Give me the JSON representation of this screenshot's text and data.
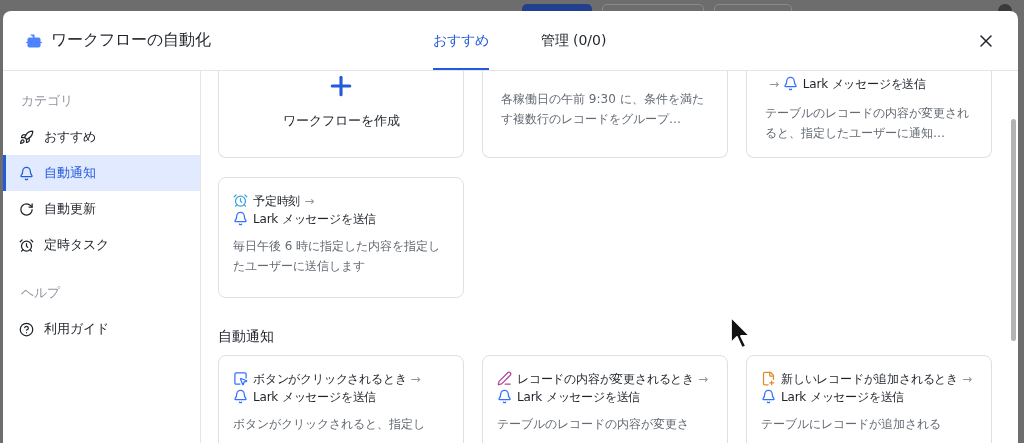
{
  "dialog": {
    "title": "ワークフローの自動化",
    "tabs": [
      {
        "label": "おすすめ",
        "selected": true
      },
      {
        "label": "管理 (0/0)",
        "selected": false
      }
    ]
  },
  "sidebar": {
    "sections": [
      {
        "heading": "カテゴリ",
        "items": [
          {
            "label": "おすすめ",
            "selected": false
          },
          {
            "label": "自動通知",
            "selected": true
          },
          {
            "label": "自動更新",
            "selected": false
          },
          {
            "label": "定時タスク",
            "selected": false
          }
        ]
      },
      {
        "heading": "ヘルプ",
        "items": [
          {
            "label": "利用ガイド",
            "selected": false
          }
        ]
      }
    ]
  },
  "recommended": {
    "top_row": [
      {
        "kind": "create",
        "label": "ワークフローを作成"
      },
      {
        "kind": "workflow",
        "description": "各稼働日の午前 9:30 に、条件を満たす複数行のレコードをグループ…"
      },
      {
        "kind": "workflow",
        "arrow": "→",
        "action": "Lark メッセージを送信",
        "description": "テーブルのレコードの内容が変更されると、指定したユーザーに通知…"
      }
    ],
    "cards": [
      {
        "kind": "workflow",
        "trigger": "予定時刻",
        "arrow": "→",
        "action": "Lark メッセージを送信",
        "description": "毎日午後 6 時に指定した内容を指定したユーザーに送信します"
      }
    ]
  },
  "sections": [
    {
      "heading": "自動通知",
      "cards": [
        {
          "kind": "workflow",
          "trigger": "ボタンがクリックされるとき",
          "arrow": "→",
          "action": "Lark メッセージを送信",
          "description": "ボタンがクリックされると、指定し"
        },
        {
          "kind": "workflow",
          "trigger": "レコードの内容が変更されるとき",
          "arrow": "→",
          "action": "Lark メッセージを送信",
          "description": "テーブルのレコードの内容が変更さ"
        },
        {
          "kind": "workflow",
          "trigger": "新しいレコードが追加されるとき",
          "arrow": "→",
          "action": "Lark メッセージを送信",
          "description": "テーブルにレコードが追加される"
        }
      ]
    }
  ]
}
